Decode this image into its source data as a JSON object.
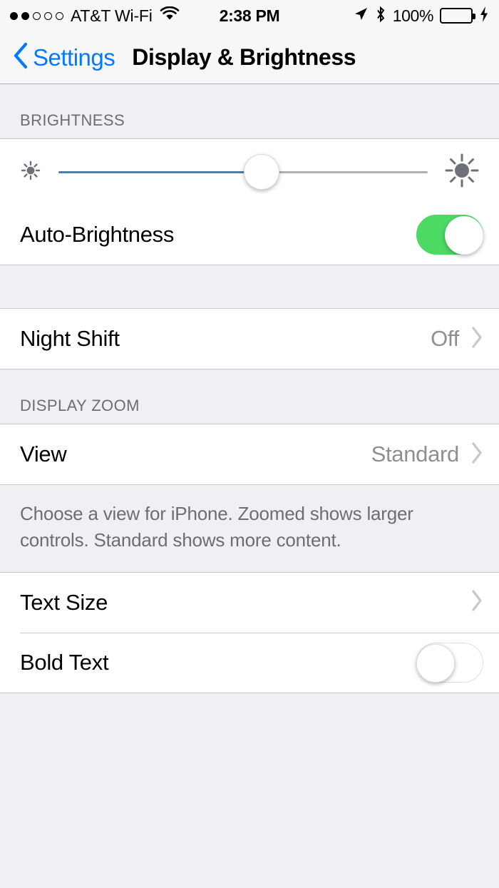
{
  "status_bar": {
    "signal_dots_filled": 2,
    "signal_dots_total": 5,
    "carrier": "AT&T Wi-Fi",
    "wifi_icon": "wifi-icon",
    "time": "2:38 PM",
    "location_icon": "location-arrow-icon",
    "bluetooth_icon": "bluetooth-icon",
    "battery_percent": "100%",
    "battery_level": 100,
    "battery_color": "#4CD964",
    "charging_icon": "lightning-bolt-icon"
  },
  "nav_bar": {
    "back_icon": "chevron-left-icon",
    "back_label": "Settings",
    "title": "Display & Brightness",
    "accent_color": "#007AFF"
  },
  "brightness_section": {
    "header": "BRIGHTNESS",
    "slider": {
      "low_icon": "sun-small-icon",
      "high_icon": "sun-large-icon",
      "value_percent": 55,
      "fill_color": "#4C7FA6",
      "track_color": "#B0B0B0"
    },
    "auto_brightness": {
      "label": "Auto-Brightness",
      "toggle_state": "on",
      "on_color": "#4CD964"
    }
  },
  "night_shift_section": {
    "row": {
      "label": "Night Shift",
      "value": "Off",
      "chevron_icon": "chevron-right-icon"
    }
  },
  "display_zoom_section": {
    "header": "DISPLAY ZOOM",
    "row": {
      "label": "View",
      "value": "Standard",
      "chevron_icon": "chevron-right-icon"
    },
    "footer": "Choose a view for iPhone. Zoomed shows larger controls. Standard shows more content."
  },
  "text_section": {
    "text_size": {
      "label": "Text Size",
      "chevron_icon": "chevron-right-icon"
    },
    "bold_text": {
      "label": "Bold Text",
      "toggle_state": "off"
    }
  }
}
